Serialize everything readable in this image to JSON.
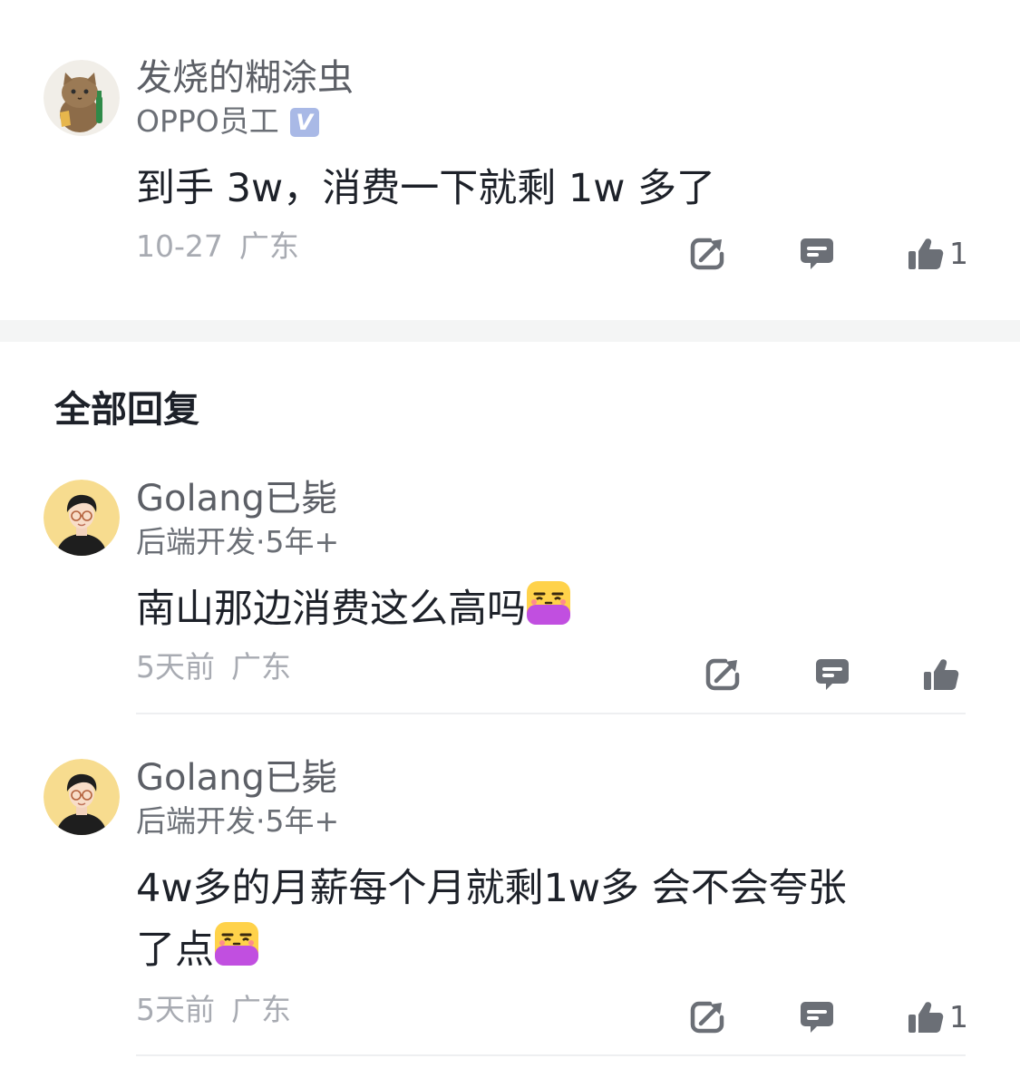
{
  "main_comment": {
    "username": "发烧的糊涂虫",
    "title": "OPPO员工",
    "verified_badge": "V",
    "content": "到手 3w，消费一下就剩 1w 多了",
    "date": "10-27",
    "location": "广东",
    "like_count": "1"
  },
  "replies_header": "全部回复",
  "replies": [
    {
      "username": "Golang已毙",
      "title": "后端开发·5年+",
      "content_line1": "南山那边消费这么高吗",
      "emoji": "大无语",
      "date": "5天前",
      "location": "广东",
      "like_count": ""
    },
    {
      "username": "Golang已毙",
      "title": "后端开发·5年+",
      "content_line1": "4w多的月薪每个月就剩1w多 会不会夸张",
      "content_line2": "了点",
      "emoji": "大无语",
      "date": "5天前",
      "location": "广东",
      "like_count": "1"
    }
  ],
  "icons": {
    "share": "share-icon",
    "comment": "comment-icon",
    "like": "thumbs-up-icon"
  }
}
